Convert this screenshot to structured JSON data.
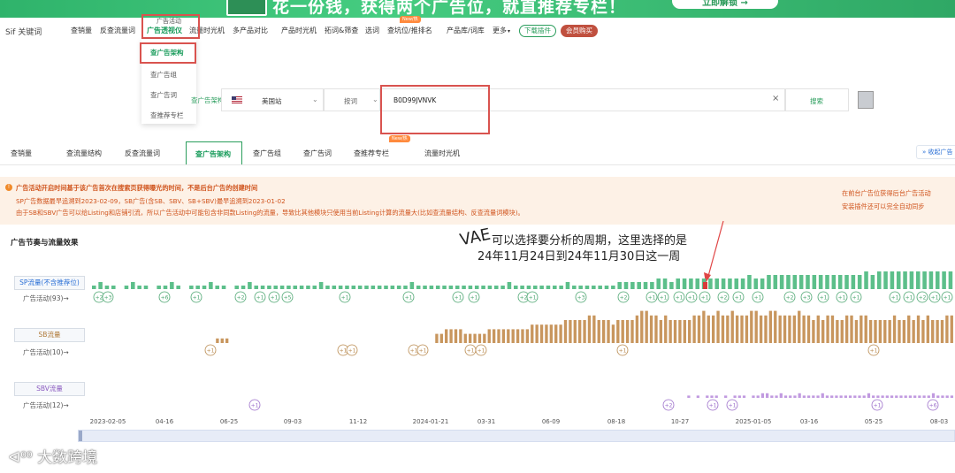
{
  "banner": {
    "slogan": "花一份钱，获得两个广告位，就直推荐专栏！",
    "cta": "立即解锁 →"
  },
  "nav": {
    "logo": "Sif 关键词",
    "items": [
      "查销量",
      "反查流量词",
      "广告透视仪",
      "流量时光机",
      "多产品对比",
      "产品时光机",
      "拓词&筛查",
      "选词",
      "查坑位/推排名",
      "产品库/词库",
      "更多"
    ],
    "hot_label": "广告活动",
    "hot_badge": "New/热",
    "download_btn": "下载插件",
    "vip_btn": "会员购买"
  },
  "dropdown": {
    "items": [
      "查广告架构",
      "查广告组",
      "查广告词",
      "查推荐专栏"
    ],
    "selected": "查广告架构"
  },
  "search": {
    "left_label": "查广告架构",
    "marketplace": "美国站",
    "type": "按词",
    "value": "B0D99JVNVK",
    "search_btn": "搜索"
  },
  "tabs": {
    "items": [
      "查销量",
      "查流量结构",
      "反查流量词",
      "查广告架构",
      "查广告组",
      "查广告词",
      "查推荐专栏",
      "流量时光机"
    ],
    "active": "查广告架构",
    "right": "收起广告"
  },
  "notice": {
    "main": "广告活动开启时间基于该广告首次在搜索页获得曝光的时间，不是后台广告的创建时间",
    "line1": "SP广告数据最早追溯到2023-02-09，SB广告(含SB、SBV、SB+SBV)最早追溯到2023-01-02",
    "line2": "由于SB和SBV广告可以给Listing和店铺引流，所以广告活动中可能包含非同款Listing的流量，导致比其他模块只使用当前Listing计算的流量大(比如查流量结构、反查流量词模块)。",
    "right1": "在前台广告位获得后台广告活动",
    "right2": "安装插件还可以完全自动同步"
  },
  "section": {
    "title": "广告节奏与流量效果",
    "annotation_line1": "可以选择要分析的周期，这里选择的是",
    "annotation_line2": "24年11月24日到24年11月30日这一周",
    "handwritten": "VAE"
  },
  "rows": [
    {
      "label": "SP流量(不含推荐位)",
      "activity": "广告活动(93)→"
    },
    {
      "label": "SB流量",
      "activity": "广告活动(10)→"
    },
    {
      "label": "SBV流量",
      "activity": "广告活动(12)→"
    }
  ],
  "axis_ticks": [
    "2023-02-05",
    "04-16",
    "06-25",
    "09-03",
    "11-12",
    "2024-01-21",
    "03-31",
    "06-09",
    "08-18",
    "10-27",
    "2025-01-05",
    "03-16",
    "05-25",
    "08-03"
  ],
  "chart_data": {
    "type": "bar",
    "x_ticks": [
      "2023-02-05",
      "04-16",
      "06-25",
      "09-03",
      "11-12",
      "2024-01-21",
      "03-31",
      "06-09",
      "08-18",
      "10-27",
      "2025-01-05",
      "03-16",
      "05-25",
      "08-03"
    ],
    "highlighted_week": "2024-11-24 ~ 2024-11-30",
    "series": [
      {
        "name": "SP流量(不含推荐位)",
        "color": "#5cbf8a",
        "values": [
          1,
          2,
          1,
          1,
          0,
          1,
          2,
          1,
          1,
          0,
          1,
          1,
          2,
          1,
          0,
          1,
          1,
          1,
          2,
          1,
          1,
          0,
          1,
          1,
          2,
          1,
          1,
          1,
          1,
          1,
          1,
          1,
          1,
          1,
          1,
          2,
          1,
          1,
          1,
          1,
          1,
          1,
          1,
          1,
          1,
          1,
          1,
          1,
          1,
          2,
          1,
          1,
          1,
          1,
          1,
          1,
          1,
          1,
          1,
          1,
          1,
          1,
          1,
          1,
          2,
          1,
          1,
          1,
          1,
          1,
          1,
          1,
          1,
          2,
          1,
          1,
          1,
          1,
          1,
          1,
          1,
          2,
          2,
          2,
          2,
          2,
          2,
          3,
          3,
          2,
          3,
          3,
          3,
          3,
          3,
          3,
          3,
          3,
          3,
          3,
          3,
          4,
          3,
          3,
          4,
          4,
          4,
          4,
          4,
          4,
          4,
          4,
          4,
          4,
          4,
          4,
          4,
          4,
          4,
          5,
          4,
          5,
          5,
          5,
          5,
          5,
          5,
          5,
          5,
          5,
          5,
          5,
          5
        ]
      },
      {
        "name": "SB流量",
        "color": "#c8965e",
        "values": [
          0,
          0,
          0,
          0,
          0,
          0,
          0,
          0,
          0,
          0,
          0,
          0,
          0,
          0,
          0,
          0,
          0,
          0,
          0,
          0,
          0,
          0,
          0,
          0,
          0,
          0,
          1,
          1,
          1,
          0,
          0,
          0,
          0,
          0,
          0,
          0,
          0,
          0,
          0,
          0,
          0,
          0,
          0,
          0,
          0,
          0,
          0,
          0,
          0,
          0,
          0,
          0,
          0,
          0,
          0,
          0,
          0,
          0,
          0,
          0,
          0,
          0,
          0,
          0,
          0,
          0,
          0,
          0,
          0,
          0,
          0,
          0,
          2,
          2,
          3,
          3,
          3,
          3,
          2,
          2,
          2,
          2,
          2,
          3,
          3,
          3,
          3,
          3,
          3,
          3,
          3,
          3,
          4,
          4,
          4,
          4,
          4,
          4,
          4,
          5,
          5,
          5,
          5,
          5,
          6,
          6,
          5,
          5,
          5,
          4,
          5,
          5,
          5,
          5,
          6,
          7,
          7,
          6,
          6,
          5,
          6,
          5,
          5,
          5,
          5,
          5,
          6,
          6,
          7,
          6,
          6,
          7,
          6,
          6,
          7,
          6,
          6,
          6,
          7,
          7,
          6,
          6,
          7,
          7,
          6,
          6,
          6,
          6,
          7,
          6,
          6,
          5,
          6,
          5,
          6,
          6,
          5,
          5,
          6,
          6,
          5,
          6,
          6,
          5,
          5,
          5,
          5,
          5,
          6,
          5,
          5,
          6,
          5,
          6,
          5,
          6,
          5,
          5,
          5,
          6,
          6
        ]
      },
      {
        "name": "SBV流量",
        "color": "#c19ae0",
        "values": [
          0,
          0,
          0,
          0,
          0,
          0,
          0,
          0,
          0,
          0,
          0,
          0,
          0,
          0,
          0,
          0,
          0,
          0,
          0,
          0,
          0,
          0,
          0,
          0,
          0,
          0,
          0,
          0,
          0,
          0,
          0,
          0,
          0,
          0,
          0,
          0,
          0,
          0,
          0,
          0,
          0,
          0,
          0,
          0,
          0,
          0,
          0,
          0,
          0,
          0,
          0,
          0,
          0,
          0,
          0,
          0,
          0,
          0,
          0,
          0,
          0,
          0,
          0,
          0,
          0,
          0,
          0,
          0,
          0,
          0,
          0,
          0,
          0,
          0,
          0,
          0,
          0,
          0,
          0,
          0,
          0,
          0,
          0,
          0,
          0,
          0,
          0,
          0,
          0,
          0,
          0,
          0,
          0,
          0,
          0,
          0,
          0,
          0,
          0,
          0,
          0,
          0,
          0,
          0,
          0,
          0,
          0,
          0,
          0,
          0,
          0,
          0,
          0,
          0,
          0,
          0,
          0,
          0,
          0,
          0,
          0,
          0,
          0,
          0,
          0,
          0,
          0,
          0,
          0,
          1,
          0,
          1,
          0,
          1,
          1,
          1,
          0,
          1,
          0,
          1,
          1,
          1,
          0,
          1,
          1,
          2,
          2,
          1,
          1,
          2,
          1,
          1,
          1,
          2,
          1,
          1,
          1,
          1,
          2,
          1,
          1,
          1,
          1,
          1,
          1,
          1,
          1,
          1,
          2,
          1,
          1,
          1,
          1,
          1,
          1,
          1,
          1,
          1,
          1,
          1,
          1,
          1,
          2,
          1,
          1,
          1,
          1
        ]
      }
    ],
    "markers": {
      "sp": [
        "+2",
        "+3",
        "+6",
        "+1",
        "+2",
        "+1",
        "+1",
        "+5",
        "+1",
        "+1",
        "+1",
        "+1",
        "+2",
        "+1",
        "+3",
        "+2",
        "+1",
        "+1",
        "+1",
        "+1",
        "+1",
        "+2",
        "+1",
        "+1",
        "+2",
        "+3",
        "+1",
        "+1",
        "+1",
        "+1",
        "+1",
        "+2",
        "+1",
        "+1"
      ],
      "sb": [
        "+1",
        "+1",
        "+1",
        "+1",
        "+1",
        "+1",
        "+1",
        "+1",
        "+1"
      ],
      "sbv": [
        "+1",
        "+2",
        "+1",
        "+1",
        "+1",
        "+6"
      ]
    }
  },
  "watermark": "大数跨境"
}
